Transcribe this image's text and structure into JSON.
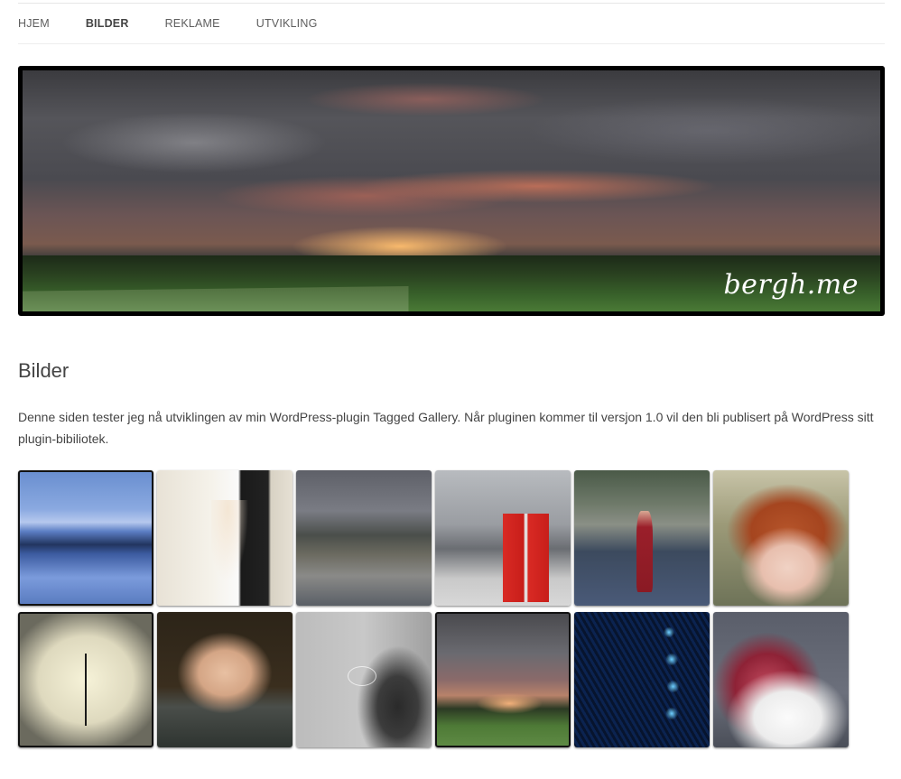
{
  "nav": {
    "items": [
      {
        "label": "HJEM"
      },
      {
        "label": "BILDER",
        "active": true
      },
      {
        "label": "REKLAME"
      },
      {
        "label": "UTVIKLING"
      }
    ]
  },
  "banner": {
    "logo_text": "bergh.me"
  },
  "page": {
    "title": "Bilder",
    "intro": "Denne siden tester jeg nå utviklingen av min WordPress-plugin Tagged Gallery. Når pluginen kommer til versjon 1.0 vil den bli publisert på WordPress sitt plugin-bibiliotek."
  },
  "gallery": {
    "thumbnail_count": 12
  }
}
